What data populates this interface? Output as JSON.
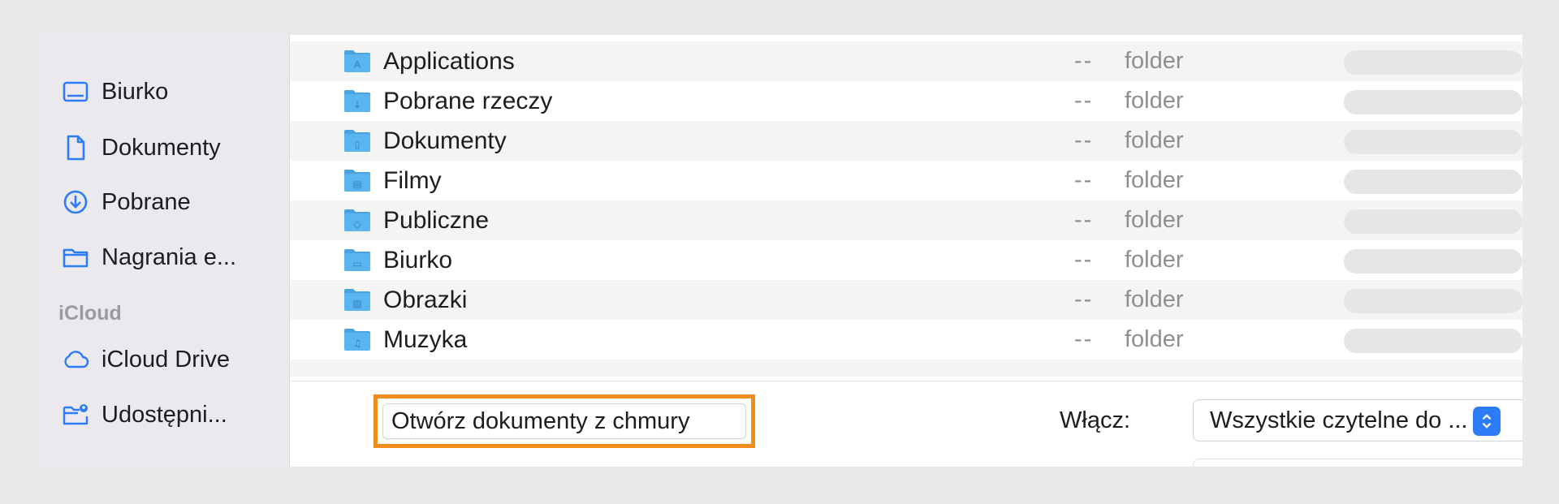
{
  "sidebar": {
    "items": [
      {
        "label": "Biurko",
        "icon": "desktop-icon"
      },
      {
        "label": "Dokumenty",
        "icon": "document-icon"
      },
      {
        "label": "Pobrane",
        "icon": "download-icon"
      },
      {
        "label": "Nagrania e...",
        "icon": "folder-icon"
      }
    ],
    "section_icloud": "iCloud",
    "icloud_items": [
      {
        "label": "iCloud Drive",
        "icon": "cloud-icon"
      },
      {
        "label": "Udostępni...",
        "icon": "shared-folder-icon"
      }
    ]
  },
  "files": [
    {
      "name": "Applications",
      "size": "--",
      "kind": "folder",
      "glyph": "A"
    },
    {
      "name": "Pobrane rzeczy",
      "size": "--",
      "kind": "folder",
      "glyph": "↓"
    },
    {
      "name": "Dokumenty",
      "size": "--",
      "kind": "folder",
      "glyph": "▯"
    },
    {
      "name": "Filmy",
      "size": "--",
      "kind": "folder",
      "glyph": "▤"
    },
    {
      "name": "Publiczne",
      "size": "--",
      "kind": "folder",
      "glyph": "◇"
    },
    {
      "name": "Biurko",
      "size": "--",
      "kind": "folder",
      "glyph": "▭"
    },
    {
      "name": "Obrazki",
      "size": "--",
      "kind": "folder",
      "glyph": "▨"
    },
    {
      "name": "Muzyka",
      "size": "--",
      "kind": "folder",
      "glyph": "♫"
    }
  ],
  "footer": {
    "open_cloud_button": "Otwórz dokumenty z chmury",
    "enable_label": "Włącz:",
    "enable_value": "Wszystkie czytelne do ..."
  },
  "colors": {
    "accent": "#2b7cf6",
    "highlight": "#f28c1a",
    "folder": "#5ab4ee"
  }
}
